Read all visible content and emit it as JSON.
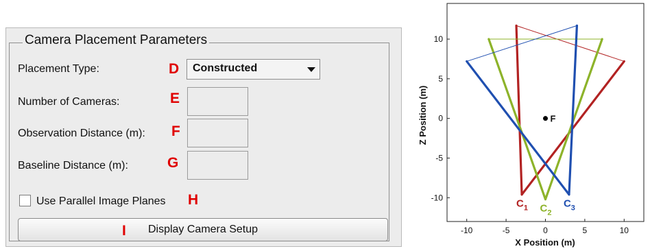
{
  "panel": {
    "title": "Camera Placement Parameters",
    "placement_type": {
      "label": "Placement Type:",
      "letter": "D",
      "selected": "Constructed"
    },
    "num_cameras": {
      "label": "Number of Cameras:",
      "letter": "E",
      "value": ""
    },
    "observation_distance": {
      "label": "Observation Distance (m):",
      "letter": "F",
      "value": ""
    },
    "baseline_distance": {
      "label": "Baseline Distance (m):",
      "letter": "G",
      "value": ""
    },
    "parallel_planes": {
      "label": "Use Parallel Image Planes",
      "letter": "H",
      "checked": false
    },
    "display_button": {
      "label": "Display Camera Setup",
      "letter": "I"
    },
    "letter_color": "#e00000"
  },
  "chart_data": {
    "type": "line",
    "title": "",
    "xlabel": "X Position (m)",
    "ylabel": "Z Position (m)",
    "xlim": [
      -12.5,
      12.5
    ],
    "ylim": [
      -13,
      14.5
    ],
    "xticks": [
      -10,
      -5,
      0,
      5,
      10
    ],
    "yticks": [
      -10,
      -5,
      0,
      5,
      10
    ],
    "grid": false,
    "focus_point": {
      "label": "F",
      "x": 0,
      "z": 0
    },
    "series": [
      {
        "camera": "C",
        "sub": "1",
        "color": "#b22222",
        "center": [
          -3,
          -9.6
        ],
        "corners": [
          -3.7,
          11.7
        ],
        "far": [
          10,
          7.2
        ]
      },
      {
        "camera": "C",
        "sub": "2",
        "color": "#8db32a",
        "center": [
          0,
          -10.2
        ],
        "corners": [
          -7.2,
          10
        ],
        "far": [
          7.2,
          10
        ]
      },
      {
        "camera": "C",
        "sub": "3",
        "color": "#1f4fb0",
        "center": [
          3,
          -9.6
        ],
        "corners": [
          -10,
          7.2
        ],
        "far": [
          4,
          11.7
        ]
      }
    ]
  }
}
